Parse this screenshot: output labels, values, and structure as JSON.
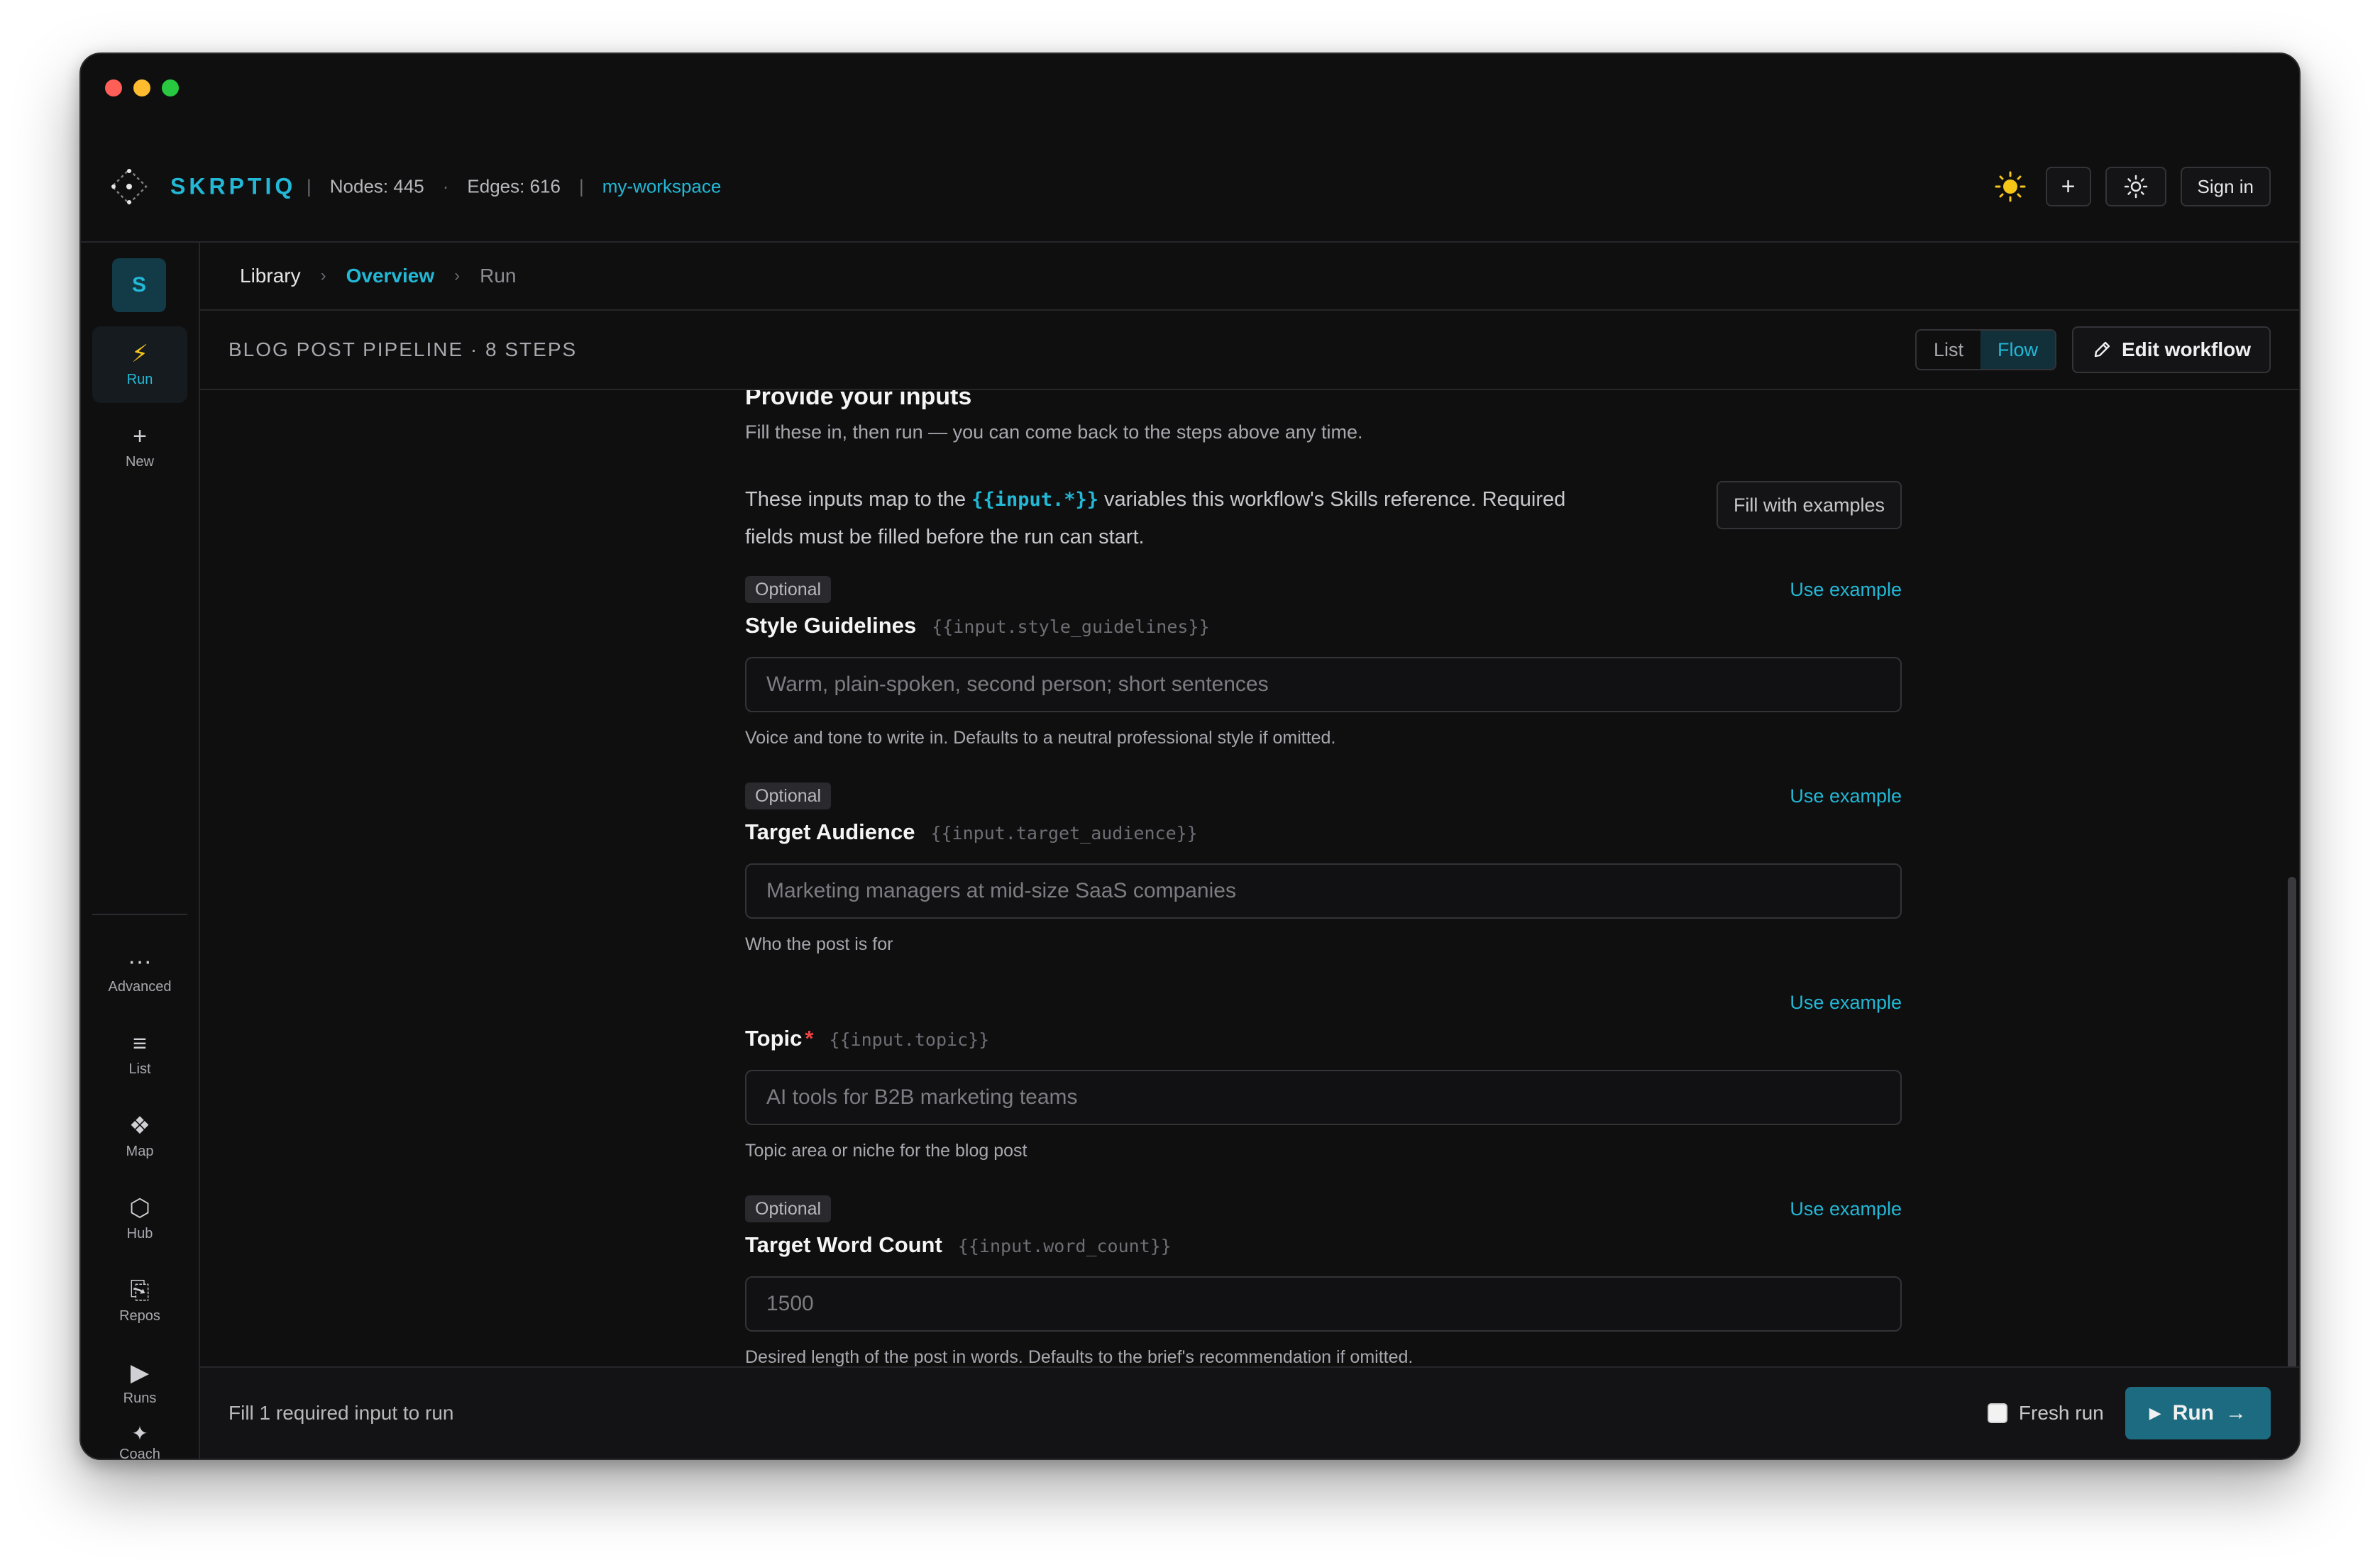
{
  "colors": {
    "accent": "#22b8d6",
    "required": "#ef4444",
    "run_button": "#1c6b80",
    "background": "#0f0f10"
  },
  "window": {
    "controls": [
      "close",
      "minimize",
      "zoom"
    ]
  },
  "topbar": {
    "brand": "SKRPTIQ",
    "sep1": "|",
    "nodes": "Nodes: 445",
    "dot": "·",
    "edges": "Edges: 616",
    "sep2": "|",
    "workspace": "my-workspace",
    "plus_label": "+",
    "sign_in": "Sign in",
    "icons": [
      "logo-icon",
      "sun-icon",
      "plus-icon",
      "settings-icon"
    ]
  },
  "sidebar": {
    "avatar": "S",
    "items": [
      {
        "label": "Run",
        "glyph": "⚡"
      },
      {
        "label": "New",
        "glyph": "+"
      },
      {
        "label": "Advanced",
        "glyph": "···"
      },
      {
        "label": "List",
        "glyph": "≡"
      },
      {
        "label": "Map",
        "glyph": "❖"
      },
      {
        "label": "Hub",
        "glyph": "⬡"
      },
      {
        "label": "Repos",
        "glyph": "⎘"
      },
      {
        "label": "Runs",
        "glyph": "▶"
      },
      {
        "label": "Coach",
        "glyph": "✦"
      }
    ]
  },
  "breadcrumb": {
    "library": "Library",
    "overview": "Overview",
    "run": "Run",
    "chevron": "›"
  },
  "header": {
    "pipeline": "BLOG POST PIPELINE · 8 STEPS",
    "view_list": "List",
    "view_flow": "Flow",
    "edit": "Edit workflow"
  },
  "inputs_section": {
    "title": "Provide your inputs",
    "subtitle": "Fill these in, then run — you can come back to the steps above any time.",
    "intro_before": "These inputs map to the ",
    "intro_code": "{{input.*}}",
    "intro_after": " variables this workflow's Skills reference. Required fields must be filled before the run can start.",
    "fill_examples": "Fill with examples",
    "use_example": "Use example",
    "optional_badge": "Optional",
    "required_mark": "*",
    "fields": [
      {
        "label": "Style Guidelines",
        "var": "{{input.style_guidelines}}",
        "placeholder": "Warm, plain-spoken, second person; short sentences",
        "help": "Voice and tone to write in. Defaults to a neutral professional style if omitted."
      },
      {
        "label": "Target Audience",
        "var": "{{input.target_audience}}",
        "placeholder": "Marketing managers at mid-size SaaS companies",
        "help": "Who the post is for"
      },
      {
        "label": "Topic",
        "var": "{{input.topic}}",
        "placeholder": "AI tools for B2B marketing teams",
        "help": "Topic area or niche for the blog post"
      },
      {
        "label": "Target Word Count",
        "var": "{{input.word_count}}",
        "placeholder": "1500",
        "help": "Desired length of the post in words. Defaults to the brief's recommendation if omitted."
      }
    ]
  },
  "footer": {
    "status": "Fill 1 required input to run",
    "fresh_run": "Fresh run",
    "run": "Run",
    "run_arrow": "→",
    "play_glyph": "▶"
  }
}
